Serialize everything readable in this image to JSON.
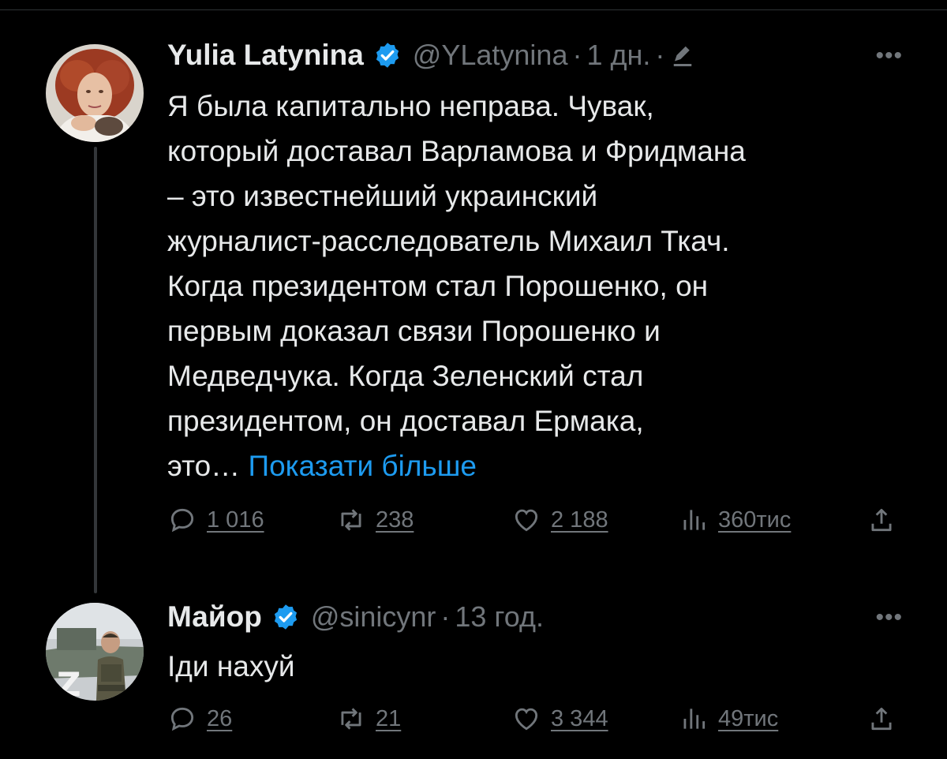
{
  "tweets": [
    {
      "author": "Yulia Latynina",
      "handle": "@YLatynina",
      "separator": "·",
      "time": "1 дн.",
      "text": "Я была капитально неправа. Чувак,\nкоторый доставал Варламова и Фридмана\n– это известнейший украинский\nжурналист-расследователь Михаил Ткач.\nКогда президентом стал Порошенко, он\nпервым доказал связи Порошенко и\nМедведчука. Когда Зеленский стал\nпрезидентом, он доставал Ермака,\nэто…",
      "show_more": "Показати більше",
      "replies": "1 016",
      "retweets": "238",
      "likes": "2 188",
      "views": "360тис",
      "edited": true
    },
    {
      "author": "Майор",
      "handle": "@sinicynr",
      "separator": "·",
      "time": "13 год.",
      "text": "Іди нахуй",
      "replies": "26",
      "retweets": "21",
      "likes": "3 344",
      "views": "49тис"
    }
  ],
  "icons": {
    "verified": "verified-badge-icon",
    "edit": "edit-pencil-icon",
    "more": "more-options-icon",
    "reply": "reply-icon",
    "retweet": "retweet-icon",
    "like": "heart-icon",
    "views": "views-chart-icon",
    "share": "share-icon"
  },
  "colors": {
    "background": "#000000",
    "text": "#e7e9ea",
    "muted": "#71767b",
    "link": "#1d9bf0",
    "verified": "#1d9bf0"
  }
}
